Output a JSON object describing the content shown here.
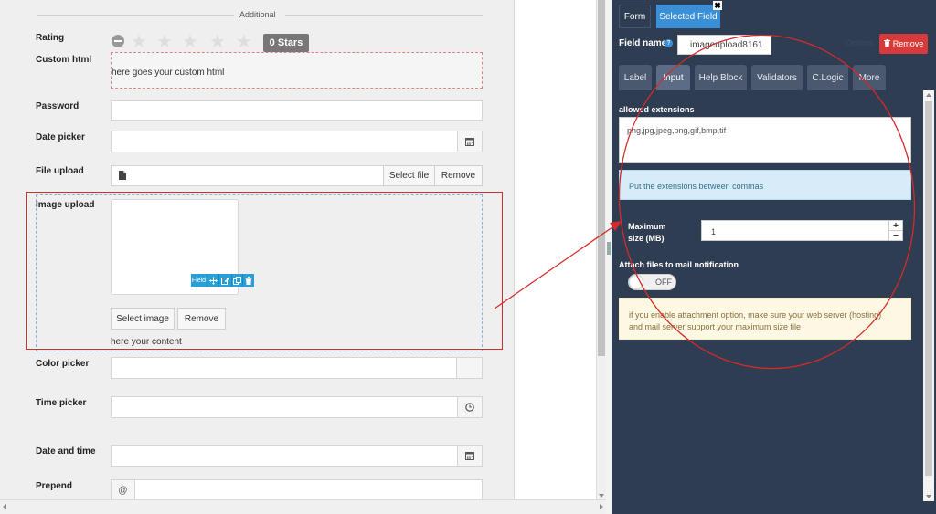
{
  "form": {
    "section_title": "Additional",
    "rating": {
      "label": "Rating",
      "stars_badge": "0 Stars",
      "star_icon": "★"
    },
    "custom_html": {
      "label": "Custom html",
      "content": "here goes your custom html"
    },
    "password": {
      "label": "Password",
      "value": ""
    },
    "date_picker": {
      "label": "Date picker",
      "value": ""
    },
    "file_upload": {
      "label": "File upload",
      "select_label": "Select file",
      "remove_label": "Remove"
    },
    "image_upload": {
      "label": "Image upload",
      "tools_label": "Field",
      "select_label": "Select image",
      "remove_label": "Remove",
      "content": "here your content"
    },
    "color_picker": {
      "label": "Color picker",
      "value": ""
    },
    "time_picker": {
      "label": "Time picker",
      "value": ""
    },
    "date_and_time": {
      "label": "Date and time",
      "value": ""
    },
    "prepend": {
      "label": "Prepend",
      "addon": "@",
      "value": ""
    }
  },
  "panel": {
    "tabs": [
      {
        "label": "Form"
      },
      {
        "label": "Selected Field"
      }
    ],
    "close_glyph": "✖",
    "field_name_label": "Field name",
    "field_name_help": "?",
    "field_name_value": "imageupload8161",
    "options_label": "Options",
    "remove_label": "Remove",
    "subtabs": [
      {
        "label": "Label"
      },
      {
        "label": "Input"
      },
      {
        "label": "Help Block"
      },
      {
        "label": "Validators"
      },
      {
        "label": "C.Logic"
      },
      {
        "label": "More"
      }
    ],
    "allowed_extensions_label": "allowed extensions",
    "allowed_extensions_value": "png,jpg,jpeg,png,gif,bmp,tif",
    "extensions_info": "Put the extensions between commas",
    "max_size_label_line1": "Maximum",
    "max_size_label_line2": "size (MB)",
    "max_size_value": "1",
    "attach_label": "Attach files to mail notification",
    "toggle_text": "OFF",
    "warning_line1": "if you enable attachment option, make sure your web server (hosting)",
    "warning_line2": "and mail server support your maximum size file"
  },
  "colors": {
    "panel_bg": "#2f3d52",
    "active_tab": "#3a8fd6",
    "remove_button": "#d63a3a",
    "annotation_red": "#d42a2a",
    "field_tools": "#27a0d8"
  }
}
